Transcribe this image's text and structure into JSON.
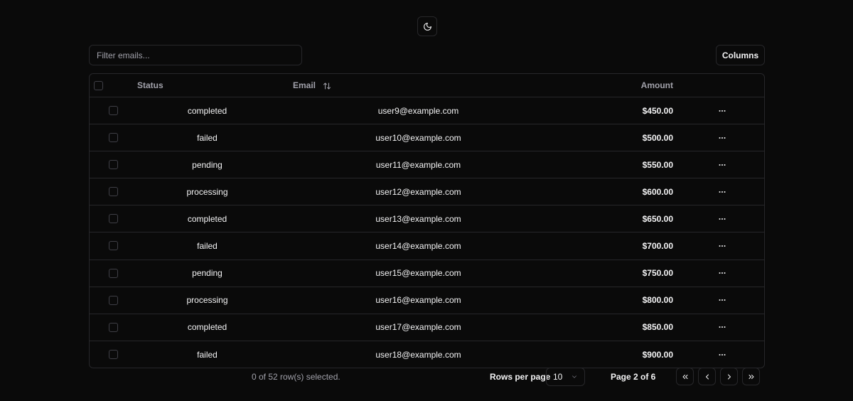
{
  "toolbar": {
    "filter_placeholder": "Filter emails...",
    "filter_value": "",
    "columns_label": "Columns"
  },
  "table": {
    "headers": {
      "status": "Status",
      "email": "Email",
      "amount": "Amount"
    },
    "rows": [
      {
        "status": "completed",
        "email": "user9@example.com",
        "amount": "$450.00"
      },
      {
        "status": "failed",
        "email": "user10@example.com",
        "amount": "$500.00"
      },
      {
        "status": "pending",
        "email": "user11@example.com",
        "amount": "$550.00"
      },
      {
        "status": "processing",
        "email": "user12@example.com",
        "amount": "$600.00"
      },
      {
        "status": "completed",
        "email": "user13@example.com",
        "amount": "$650.00"
      },
      {
        "status": "failed",
        "email": "user14@example.com",
        "amount": "$700.00"
      },
      {
        "status": "pending",
        "email": "user15@example.com",
        "amount": "$750.00"
      },
      {
        "status": "processing",
        "email": "user16@example.com",
        "amount": "$800.00"
      },
      {
        "status": "completed",
        "email": "user17@example.com",
        "amount": "$850.00"
      },
      {
        "status": "failed",
        "email": "user18@example.com",
        "amount": "$900.00"
      }
    ],
    "row_menu_label": "···"
  },
  "footer": {
    "selection_text": "0 of 52 row(s) selected.",
    "rows_per_page_label": "Rows per page",
    "rows_per_page_value": "10",
    "page_info": "Page 2 of 6"
  },
  "icons": {
    "theme_toggle": "moon-icon",
    "sort": "arrow-up-down-icon",
    "row_actions": "more-horizontal-icon",
    "select_chevron": "chevron-down-icon",
    "first_page": "chevrons-left-icon",
    "prev_page": "chevron-left-icon",
    "next_page": "chevron-right-icon",
    "last_page": "chevrons-right-icon"
  },
  "colors": {
    "background": "#0a0a0a",
    "border": "#27272a",
    "text": "#f4f4f5",
    "muted_text": "#a1a1aa"
  }
}
